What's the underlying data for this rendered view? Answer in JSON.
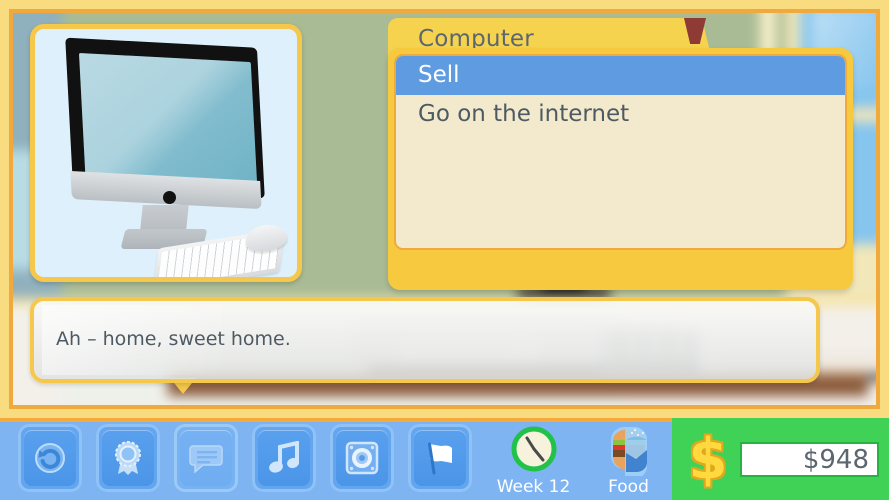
{
  "scene": {
    "name": "living-room-background"
  },
  "picture_card": {
    "name": "computer-illustration",
    "alt": "desktop-computer-with-keyboard-and-mouse"
  },
  "menu": {
    "title": "Computer",
    "items": [
      {
        "label": "Sell",
        "selected": true
      },
      {
        "label": "Go on the internet",
        "selected": false
      }
    ]
  },
  "dialog": {
    "text": "Ah – home, sweet home."
  },
  "toolbar": {
    "buttons": [
      {
        "name": "undo-button",
        "icon": "undo-icon",
        "enabled": true
      },
      {
        "name": "awards-button",
        "icon": "award-ribbon-icon",
        "enabled": true
      },
      {
        "name": "log-button",
        "icon": "speech-bubble-icon",
        "enabled": false
      },
      {
        "name": "music-button",
        "icon": "music-note-icon",
        "enabled": true
      },
      {
        "name": "sound-button",
        "icon": "speaker-icon",
        "enabled": true
      },
      {
        "name": "flag-button",
        "icon": "flag-icon",
        "enabled": true
      }
    ],
    "meters": [
      {
        "name": "week-meter",
        "icon": "clock-icon",
        "label": "Week 12"
      },
      {
        "name": "food-meter",
        "icon": "burger-icon",
        "label": "Food"
      }
    ],
    "money": {
      "icon": "dollar-sign-icon",
      "value": "$948"
    }
  },
  "colors": {
    "gold_border": "#fadc80",
    "gold_border_inner": "#f0a93c",
    "menu_frame": "#f6c93f",
    "menu_title_tab": "#f6d34e",
    "selection": "#5e9be1",
    "toolbar_blue": "#7fb4f2",
    "money_green": "#3fd257",
    "wall_green": "#a9bb95",
    "pennant_red": "#8e3a35"
  }
}
